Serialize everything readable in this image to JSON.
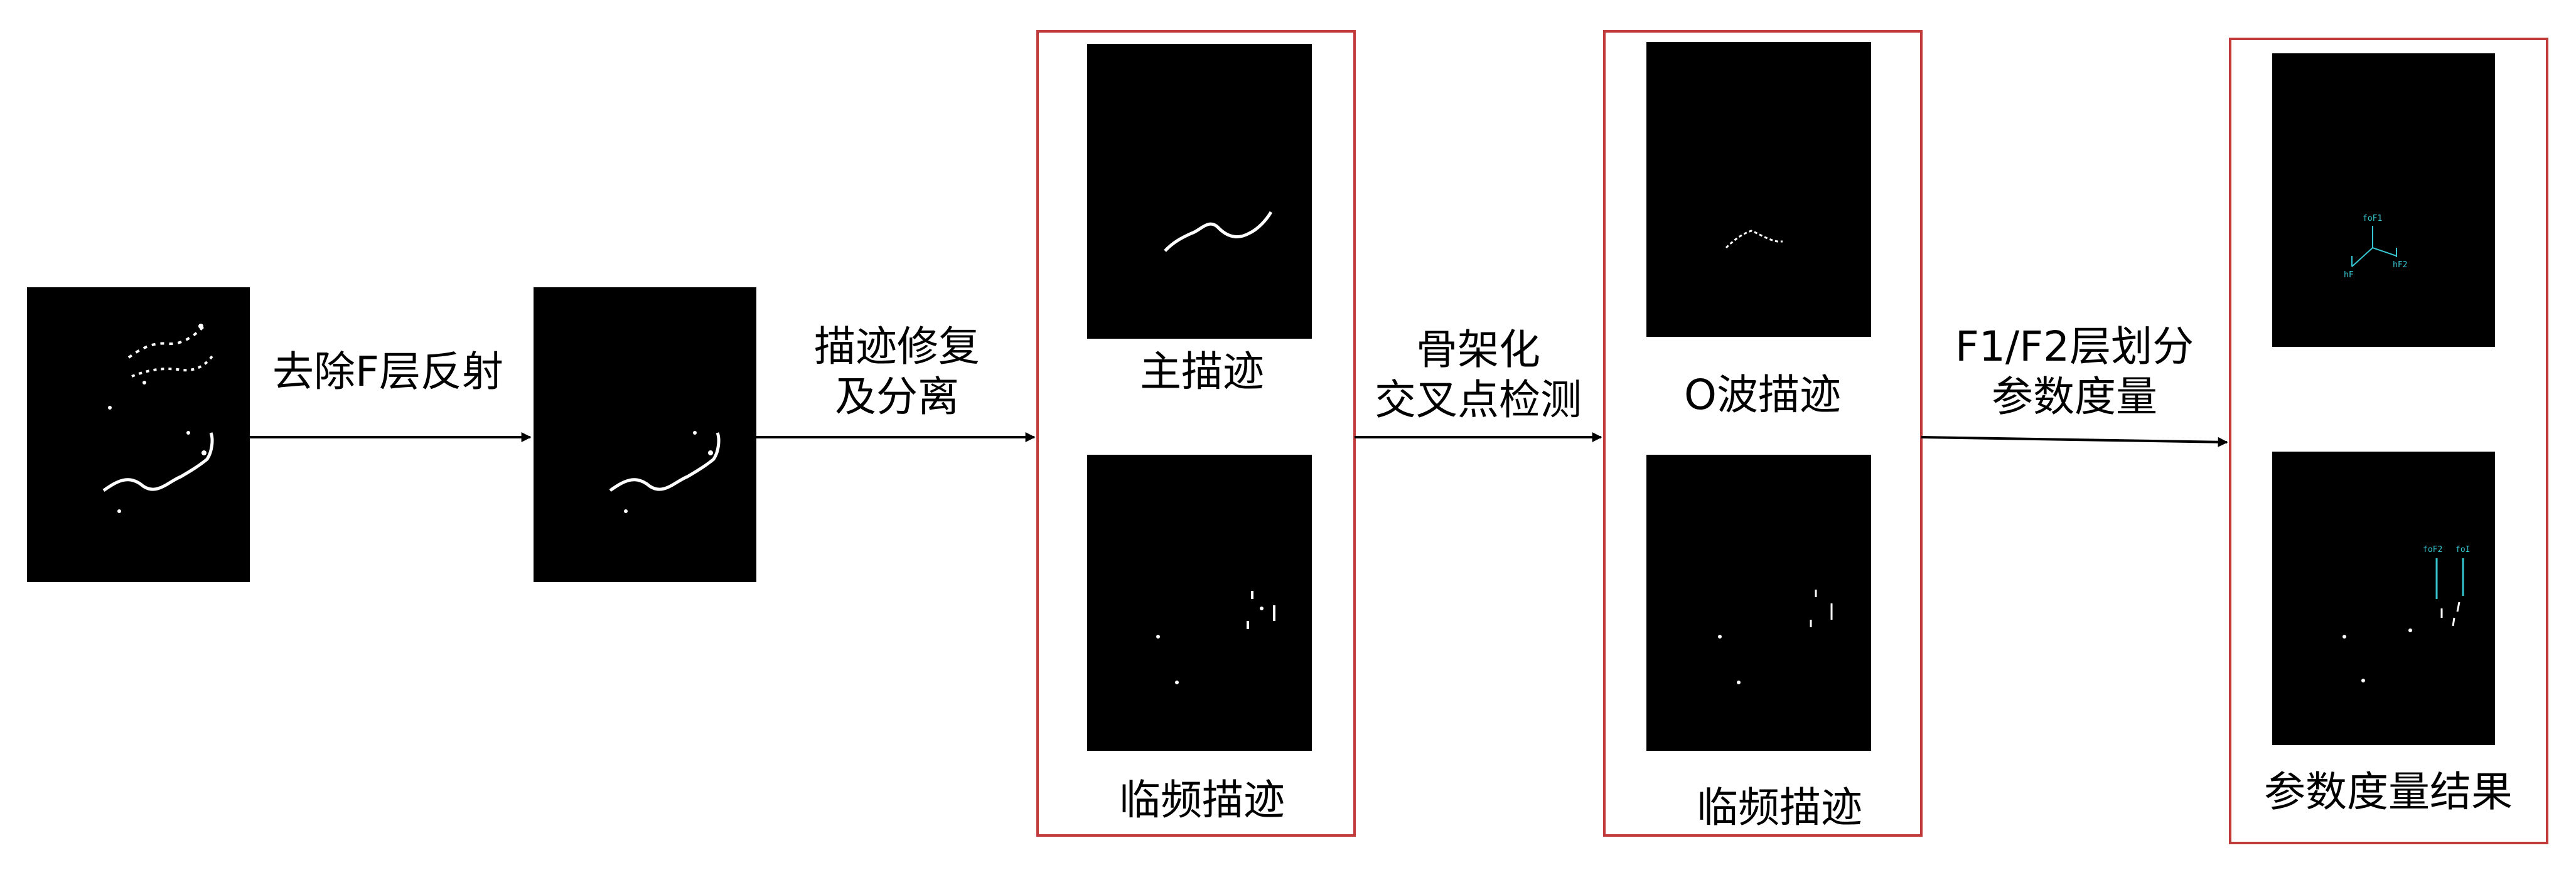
{
  "stages": {
    "remove_f_reflection": "去除F层反射",
    "trace_repair_line1": "描迹修复",
    "trace_repair_line2": "及分离",
    "skeleton_line1": "骨架化",
    "skeleton_line2": "交叉点检测",
    "division_line1": "F1/F2层划分",
    "division_line2": "参数度量"
  },
  "panels": {
    "main_trace": "主描迹",
    "critical_freq_trace": "临频描迹",
    "o_wave_trace": "O波描迹",
    "critical_freq_trace_2": "临频描迹",
    "measurement_result": "参数度量结果"
  },
  "annotations": {
    "fof1": "foF1",
    "hf": "hF",
    "hf2": "hF2",
    "fof2": "foF2",
    "foi": "foI"
  },
  "colors": {
    "box_border": "#c0393b",
    "image_bg": "#000000",
    "trace": "#ffffff",
    "annotation": "#36c6cf"
  }
}
